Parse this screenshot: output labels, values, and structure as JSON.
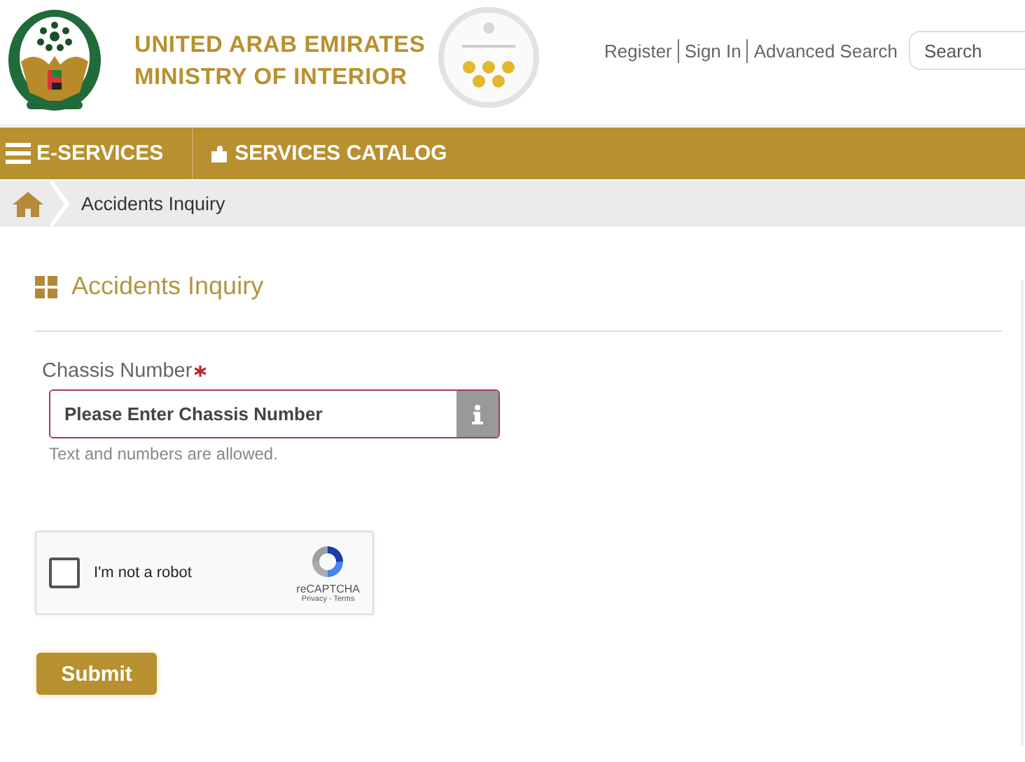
{
  "header": {
    "title_lines": [
      "UNITED ARAB EMIRATES",
      "MINISTRY OF INTERIOR"
    ],
    "links": [
      "Register",
      "Sign In",
      "Advanced Search"
    ],
    "search": {
      "placeholder": "Search"
    }
  },
  "nav": [
    {
      "label": "E-SERVICES",
      "kind": "menu"
    },
    {
      "label": "SERVICES CATALOG",
      "kind": "catalog"
    }
  ],
  "breadcrumb": [
    "Accidents Inquiry"
  ],
  "form": {
    "title": "Accidents Inquiry",
    "field": {
      "label": "Chassis Number",
      "required": true,
      "placeholder": "Please Enter Chassis Number",
      "hint": "Text and numbers are allowed."
    },
    "captcha": {
      "label": "I'm not a robot",
      "checked": false,
      "brand": "reCAPTCHA",
      "links": "Privacy - Terms"
    },
    "submit": "Submit"
  }
}
